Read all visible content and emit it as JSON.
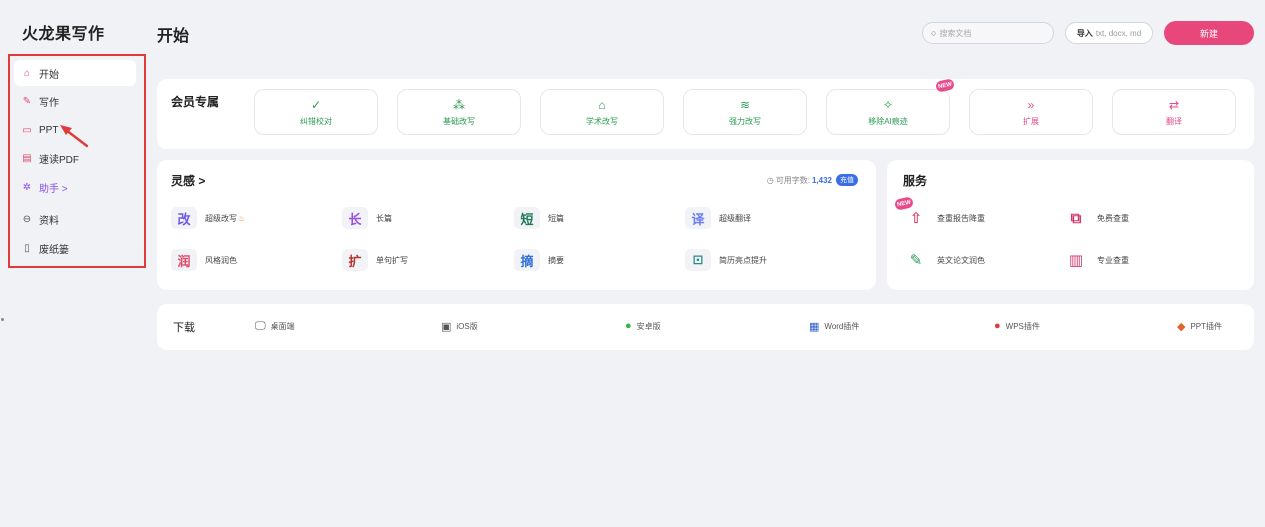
{
  "app": {
    "logo": "火龙果写作"
  },
  "sidebar": {
    "items": [
      {
        "label": "开始",
        "icon": "home-icon"
      },
      {
        "label": "写作",
        "icon": "pen-icon"
      },
      {
        "label": "PPT",
        "icon": "presentation-icon"
      },
      {
        "label": "速读PDF",
        "icon": "pdf-icon"
      },
      {
        "label": "助手 >",
        "icon": "assistant-icon"
      },
      {
        "label": "资料",
        "icon": "folder-icon"
      },
      {
        "label": "废纸篓",
        "icon": "trash-icon"
      }
    ]
  },
  "header": {
    "title": "开始",
    "search_placeholder": "搜索文档",
    "import_label": "导入",
    "import_formats": "txt, docx, md",
    "new_label": "新建"
  },
  "member": {
    "title": "会员专属",
    "badge": "NEW",
    "buttons": [
      {
        "label": "纠错校对",
        "icon": "✓"
      },
      {
        "label": "基础改写",
        "icon": "⁂"
      },
      {
        "label": "学术改写",
        "icon": "⌂"
      },
      {
        "label": "强力改写",
        "icon": "≋"
      },
      {
        "label": "移除AI痕迹",
        "icon": "✧"
      },
      {
        "label": "扩展",
        "icon": "»"
      },
      {
        "label": "翻译",
        "icon": "⇄"
      }
    ]
  },
  "inspiration": {
    "title": "灵感 >",
    "words_label": "可用字数:",
    "words_value": "1,432",
    "charge_label": "充值",
    "tools": [
      {
        "badge": "改",
        "label": "超级改写",
        "color": "#6e5ce6"
      },
      {
        "badge": "长",
        "label": "长篇",
        "color": "#9a4de6"
      },
      {
        "badge": "短",
        "label": "短篇",
        "color": "#1f7a5a"
      },
      {
        "badge": "译",
        "label": "超级翻译",
        "color": "#6c7ef0"
      },
      {
        "badge": "润",
        "label": "风格润色",
        "color": "#e04a6a"
      },
      {
        "badge": "扩",
        "label": "单句扩写",
        "color": "#b8342f"
      },
      {
        "badge": "摘",
        "label": "摘要",
        "color": "#2f6fd6"
      },
      {
        "badge": "⊡",
        "label": "简历亮点提升",
        "color": "#2a8c82"
      }
    ]
  },
  "service": {
    "title": "服务",
    "badge": "NEW",
    "items": [
      {
        "badge": "⇧",
        "label": "查重报告降重",
        "color": "#e04a6a"
      },
      {
        "badge": "⧉",
        "label": "免费查重",
        "color": "#d4386a"
      },
      {
        "badge": "✎",
        "label": "英文论文润色",
        "color": "#2a9a5a"
      },
      {
        "badge": "▥",
        "label": "专业查重",
        "color": "#d4386a"
      }
    ]
  },
  "download": {
    "title": "下载",
    "items": [
      {
        "label": "桌面端",
        "icon": "desktop-icon"
      },
      {
        "label": "iOS版",
        "icon": "ios-icon"
      },
      {
        "label": "安卓版",
        "icon": "android-icon"
      },
      {
        "label": "Word插件",
        "icon": "word-icon"
      },
      {
        "label": "WPS插件",
        "icon": "wps-icon"
      },
      {
        "label": "PPT插件",
        "icon": "ppt-icon"
      }
    ]
  }
}
